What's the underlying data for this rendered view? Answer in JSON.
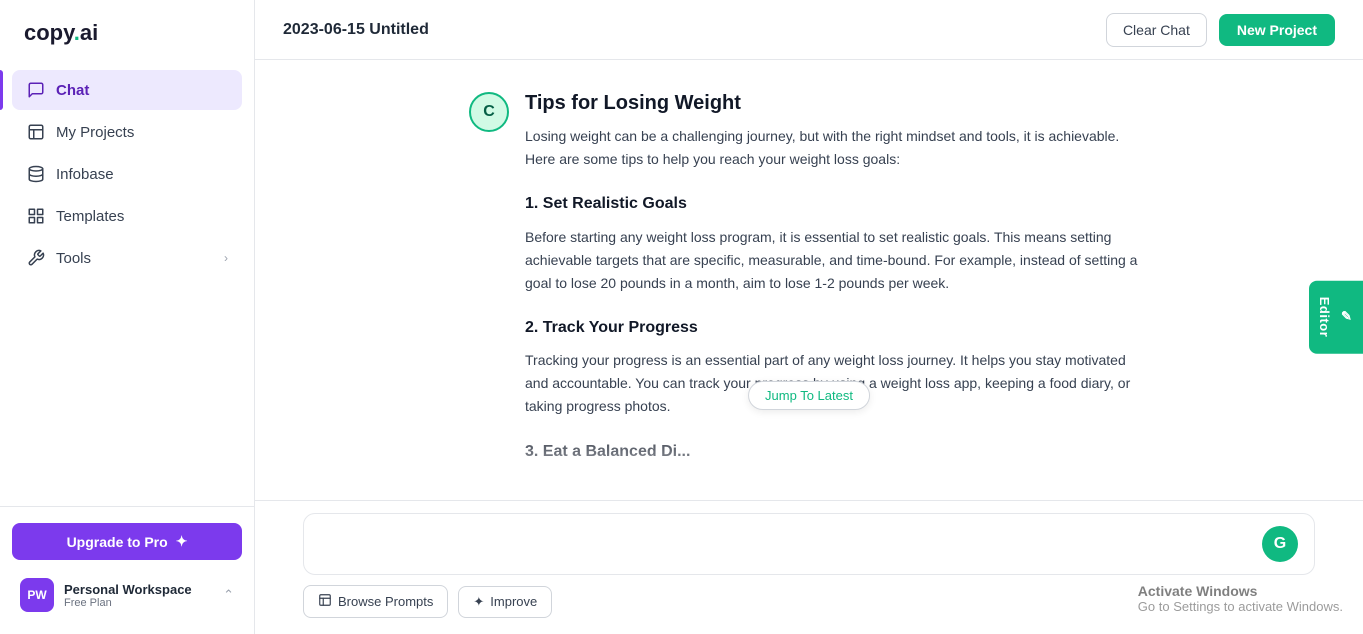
{
  "brand": {
    "name_part1": "copy",
    "name_dot": ".",
    "name_part2": "ai"
  },
  "sidebar": {
    "nav_items": [
      {
        "id": "chat",
        "label": "Chat",
        "icon": "💬",
        "active": true
      },
      {
        "id": "my-projects",
        "label": "My Projects",
        "icon": "📄",
        "active": false
      },
      {
        "id": "infobase",
        "label": "Infobase",
        "icon": "🗃️",
        "active": false
      },
      {
        "id": "templates",
        "label": "Templates",
        "icon": "⊞",
        "active": false
      },
      {
        "id": "tools",
        "label": "Tools",
        "icon": "🔧",
        "active": false,
        "has_chevron": true
      }
    ],
    "upgrade_button_label": "Upgrade to Pro",
    "workspace": {
      "initials": "PW",
      "name": "Personal Workspace",
      "plan": "Free Plan"
    }
  },
  "header": {
    "title": "2023-06-15 Untitled",
    "clear_chat_label": "Clear Chat",
    "new_project_label": "New Project"
  },
  "chat": {
    "avatar_letter": "C",
    "message_title": "Tips for Losing Weight",
    "intro_text": "Losing weight can be a challenging journey, but with the right mindset and tools, it is achievable. Here are some tips to help you reach your weight loss goals:",
    "sections": [
      {
        "heading": "1. Set Realistic Goals",
        "body": "Before starting any weight loss program, it is essential to set realistic goals. This means setting achievable targets that are specific, measurable, and time-bound. For example, instead of setting a goal to lose 20 pounds in a month, aim to lose 1-2 pounds per week."
      },
      {
        "heading": "2. Track Your Progress",
        "body": "Tracking your progress is an essential part of any weight loss journey. It helps you stay motivated and accountable. You can track your progress by using a weight loss app, keeping a food diary, or taking progress photos."
      },
      {
        "heading": "3. Eat a Balanced Di...",
        "body": ""
      }
    ],
    "jump_to_latest_label": "Jump To Latest"
  },
  "input": {
    "g_icon": "G",
    "browse_prompts_label": "Browse Prompts",
    "improve_label": "Improve"
  },
  "editor_tab": {
    "label": "Editor"
  },
  "windows": {
    "title": "Activate Windows",
    "subtitle": "Go to Settings to activate Windows."
  }
}
